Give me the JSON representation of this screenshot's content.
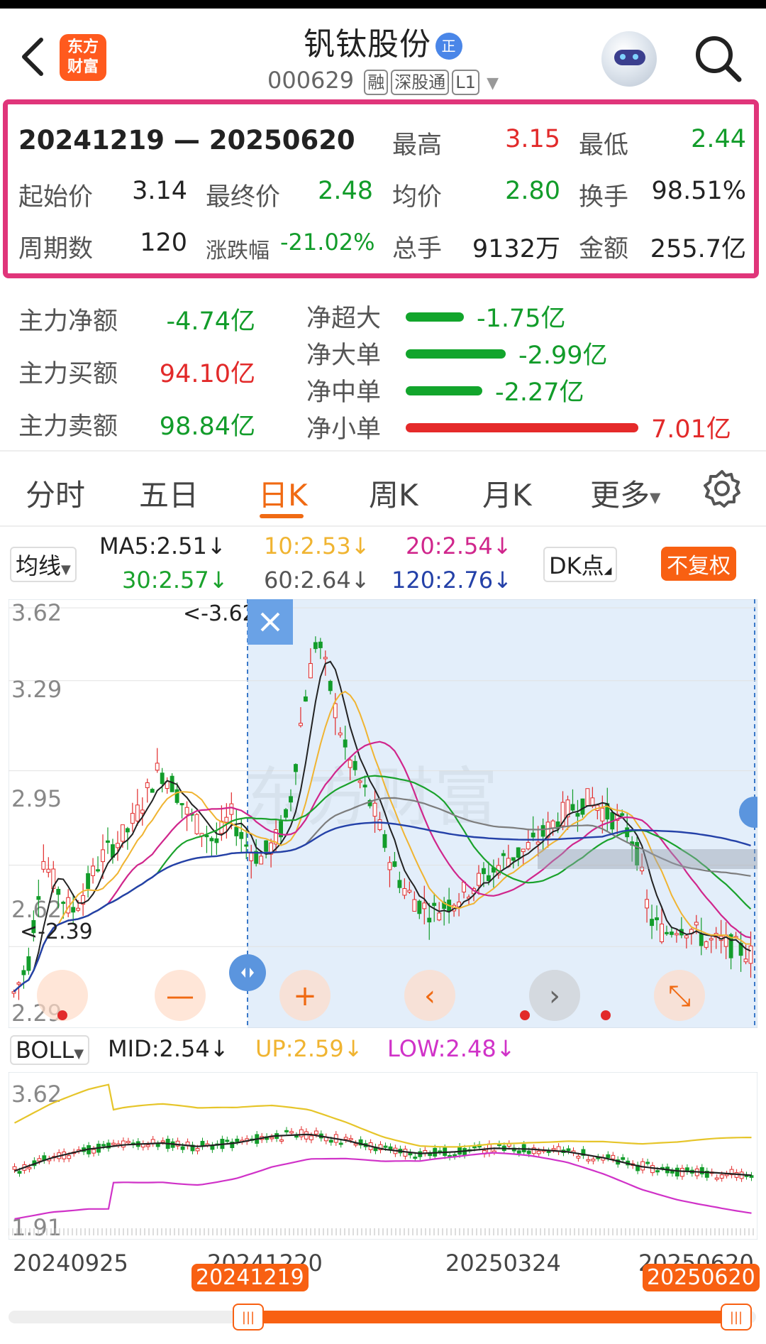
{
  "header": {
    "back_icon": "chevron-left-icon",
    "logo_line1": "东方",
    "logo_line2": "财富",
    "stock_name": "钒钛股份",
    "badge": "正",
    "code": "000629",
    "tags": [
      "融",
      "深股通",
      "L1"
    ],
    "avatar_icon": "robot-avatar-icon",
    "search_icon": "search-icon"
  },
  "summary": {
    "period": "20241219 — 20250620",
    "high_label": "最高",
    "high": "3.15",
    "low_label": "最低",
    "low": "2.44",
    "start_label": "起始价",
    "start": "3.14",
    "end_label": "最终价",
    "end": "2.48",
    "avg_label": "均价",
    "avg": "2.80",
    "turnover_label": "换手",
    "turnover": "98.51%",
    "periods_label": "周期数",
    "periods": "120",
    "change_label": "涨跌幅",
    "change": "-21.02%",
    "volume_label": "总手",
    "volume": "9132万",
    "amount_label": "金额",
    "amount": "255.7亿"
  },
  "flow": {
    "net_label": "主力净额",
    "net": "-4.74亿",
    "buy_label": "主力买额",
    "buy": "94.10亿",
    "sell_label": "主力卖额",
    "sell": "98.84亿",
    "items": [
      {
        "label": "净超大",
        "value": "-1.75亿",
        "bar_fraction": 0.25,
        "color": "#12a52c"
      },
      {
        "label": "净大单",
        "value": "-2.99亿",
        "bar_fraction": 0.43,
        "color": "#12a52c"
      },
      {
        "label": "净中单",
        "value": "-2.27亿",
        "bar_fraction": 0.33,
        "color": "#12a52c"
      },
      {
        "label": "净小单",
        "value": "7.01亿",
        "bar_fraction": 1.0,
        "color": "#e52a2a"
      }
    ]
  },
  "tabs": [
    "分时",
    "五日",
    "日K",
    "周K",
    "月K",
    "更多"
  ],
  "active_tab": "日K",
  "settings_icon": "gear-icon",
  "ma_bar": {
    "selector": "均线",
    "ma5": "MA5:2.51↓",
    "ma10": "10:2.53↓",
    "ma20": "20:2.54↓",
    "ma30": "30:2.57↓",
    "ma60": "60:2.64↓",
    "ma120": "120:2.76↓",
    "dk": "DK点",
    "adjust": "不复权"
  },
  "main_chart": {
    "y_labels": [
      "3.62",
      "3.29",
      "2.95",
      "2.62",
      "2.29"
    ],
    "max_marker": "<-3.62",
    "min_marker": "<-2.39",
    "watermark": "东方财富"
  },
  "boll_bar": {
    "selector": "BOLL",
    "mid": "MID:2.54↓",
    "up": "UP:2.59↓",
    "low": "LOW:2.48↓"
  },
  "boll_chart": {
    "y_labels": [
      "3.62",
      "1.91"
    ]
  },
  "date_axis": {
    "labels": [
      "20240925",
      "20241220",
      "20250324",
      "20250620"
    ],
    "range_start": "20241219",
    "range_end": "20250620"
  },
  "colors": {
    "ma5": "#222222",
    "ma10": "#f0b431",
    "ma20": "#d0268c",
    "ma30": "#1aa22c",
    "ma60": "#7d7d7d",
    "ma120": "#2441a8",
    "up": "#e22a2a",
    "down": "#129c2a",
    "accent": "#f06a13",
    "highlight": "#e0357a"
  }
}
